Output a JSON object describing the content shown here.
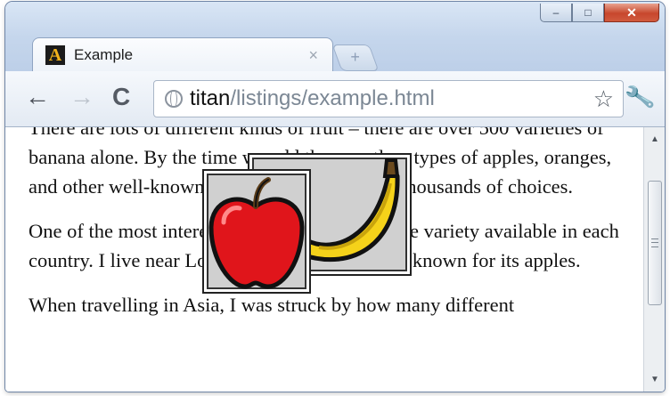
{
  "window": {
    "caption_buttons": {
      "minimize": "–",
      "maximize": "□",
      "close": "✕"
    }
  },
  "tab": {
    "favicon_letter": "A",
    "title": "Example",
    "close_glyph": "×",
    "new_tab_glyph": "+"
  },
  "toolbar": {
    "back_glyph": "←",
    "forward_glyph": "→",
    "reload_glyph": "C",
    "url_host": "titan",
    "url_path": "/listings/example.html",
    "star_glyph": "☆",
    "wrench_glyph": "🔧"
  },
  "content": {
    "paragraph_1": "There are lots of different kinds of fruit – there are over 500 varieties of banana alone. By the time we add the countless types of apples, oranges, and other well-known fruit, we are faced with thousands of choices.",
    "paragraph_2": "One of the most interesting aspects of fruit is the variety available in each country. I live near London, in an area which is known for its apples.",
    "paragraph_3": "When travelling in Asia, I was struck by how many different"
  },
  "images": [
    {
      "name": "banana",
      "icon": "banana-image"
    },
    {
      "name": "apple",
      "icon": "apple-image"
    }
  ],
  "scrollbar": {
    "up_glyph": "▲",
    "down_glyph": "▼",
    "position": 0.25
  },
  "colors": {
    "apple": "#e0151b",
    "banana": "#f5d21a",
    "image_background": "#d0d0d0"
  }
}
